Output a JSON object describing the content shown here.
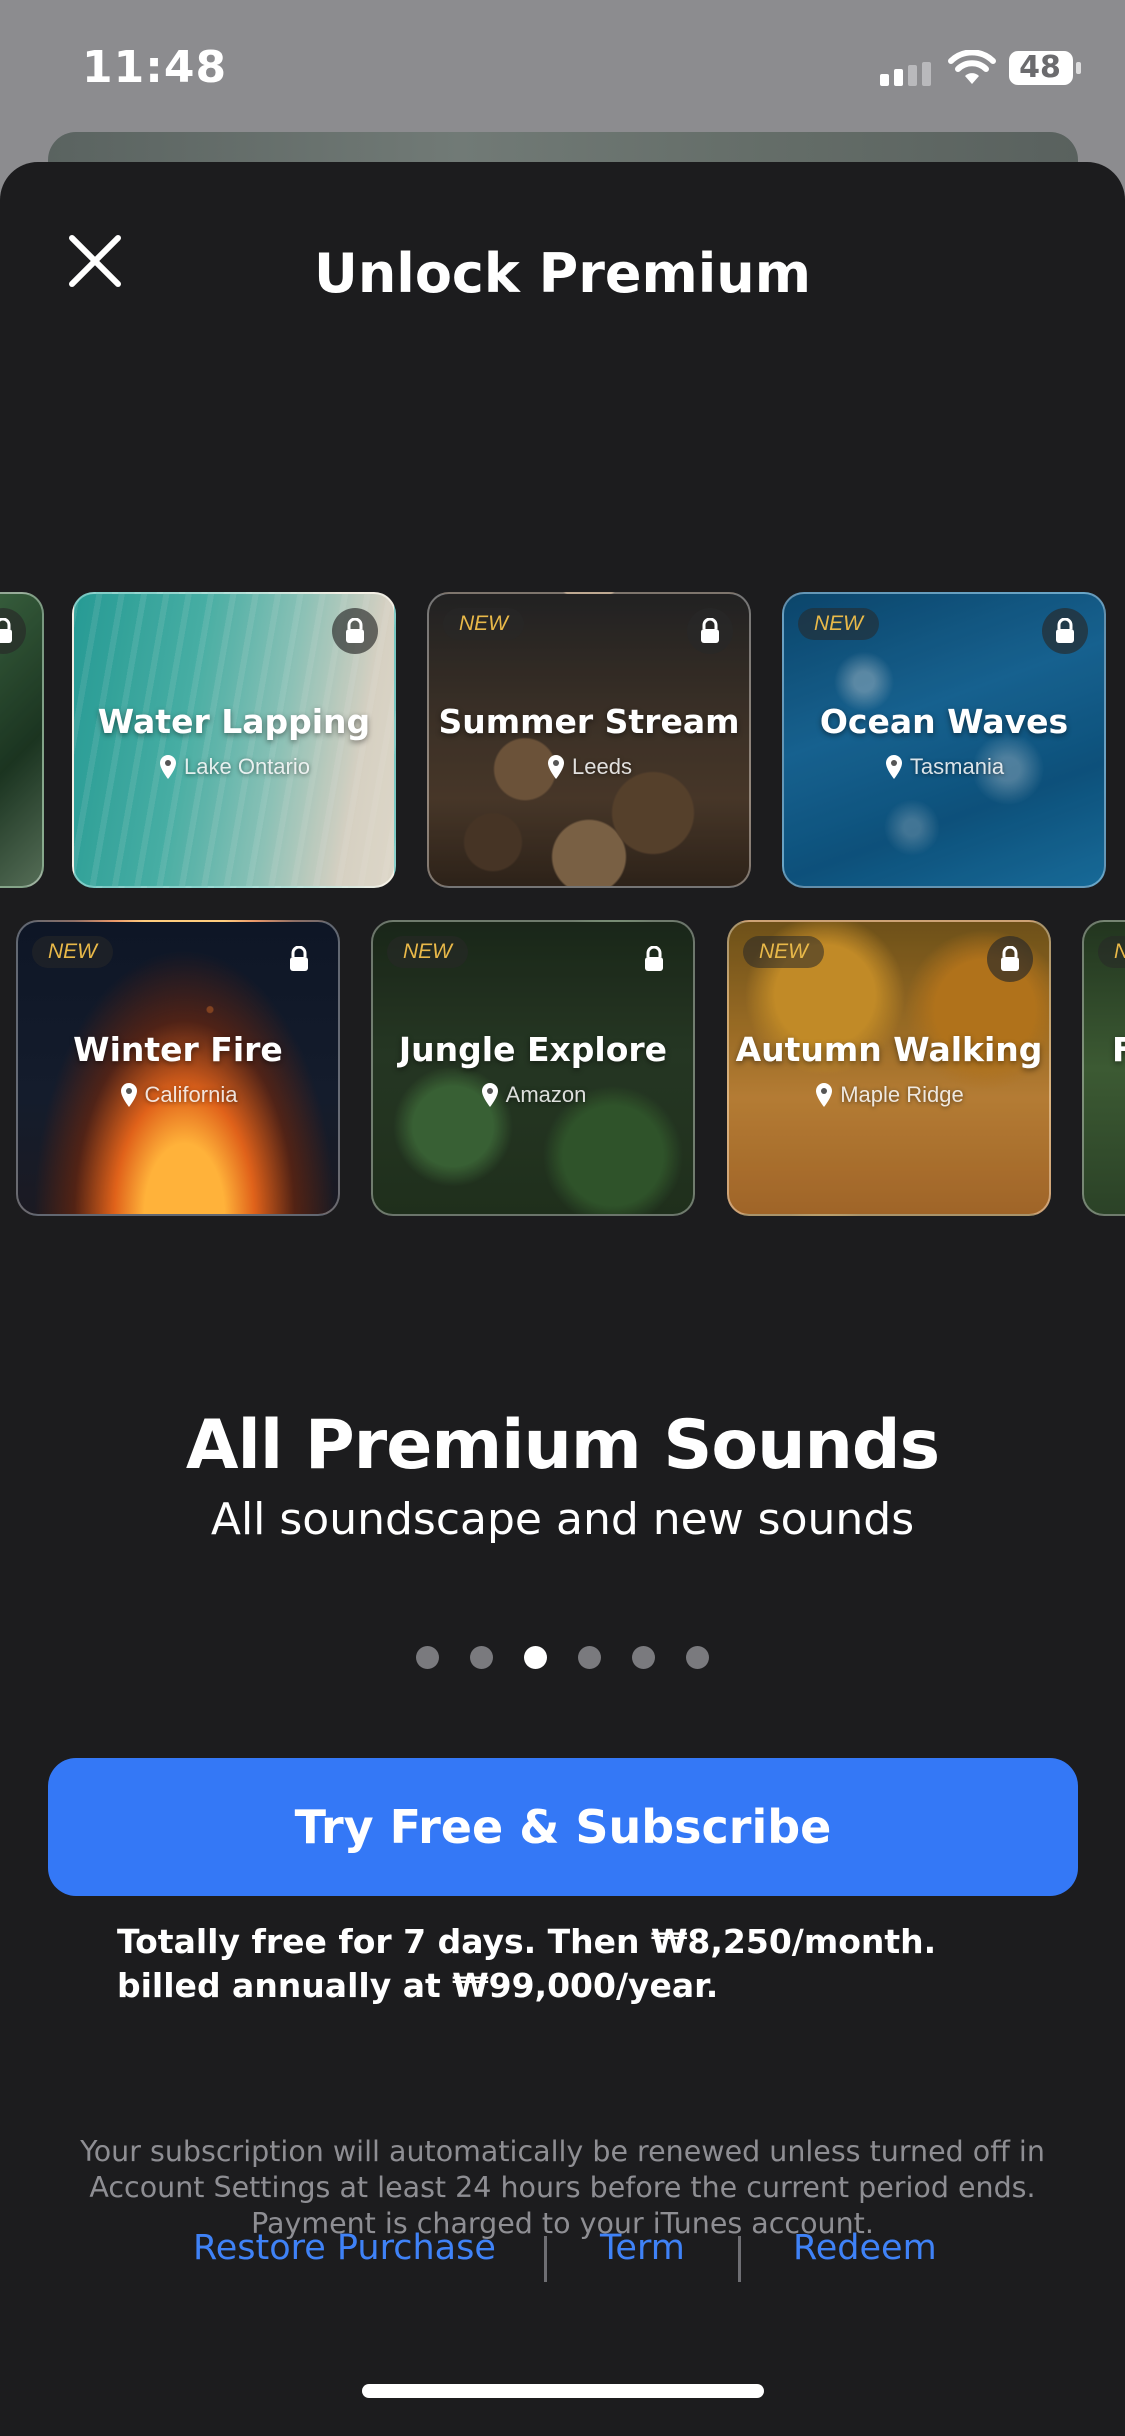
{
  "status_bar": {
    "time": "11:48",
    "battery": "48"
  },
  "header": {
    "title": "Unlock Premium"
  },
  "carousel": {
    "row1": [
      {
        "name": "",
        "location": "",
        "is_new": false,
        "locked": true
      },
      {
        "name": "Water Lapping",
        "location": "Lake Ontario",
        "is_new": false,
        "locked": true
      },
      {
        "name": "Summer Stream",
        "location": "Leeds",
        "is_new": true,
        "locked": true
      },
      {
        "name": "Ocean Waves",
        "location": "Tasmania",
        "is_new": true,
        "locked": true
      }
    ],
    "row2": [
      {
        "name": "Winter Fire",
        "location": "California",
        "is_new": true,
        "locked": true
      },
      {
        "name": "Jungle Explore",
        "location": "Amazon",
        "is_new": true,
        "locked": true
      },
      {
        "name": "Autumn Walking",
        "location": "Maple Ridge",
        "is_new": true,
        "locked": true
      },
      {
        "name": "F",
        "location": "",
        "is_new": true,
        "locked": false
      }
    ],
    "new_label": "NEW"
  },
  "feature": {
    "title": "All Premium Sounds",
    "subtitle": "All soundscape and new sounds"
  },
  "pager": {
    "count": 6,
    "active_index": 2
  },
  "cta": {
    "label": "Try Free & Subscribe"
  },
  "pricing": {
    "text": "Totally free for 7 days. Then ₩8,250/month. billed annually at ₩99,000/year."
  },
  "legal": {
    "text": "Your subscription will automatically be renewed unless turned off in Account Settings at least 24 hours before the current period ends. Payment is charged to your iTunes account."
  },
  "footer": {
    "restore": "Restore Purchase",
    "term": "Term",
    "redeem": "Redeem"
  },
  "colors": {
    "accent": "#3478F6",
    "link": "#3F82F7",
    "new_badge": "#E9B949",
    "sheet_bg": "#1C1C1E"
  }
}
